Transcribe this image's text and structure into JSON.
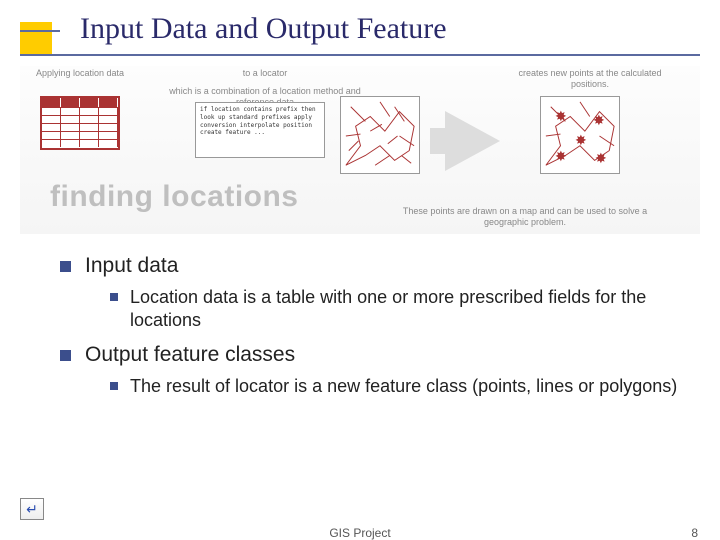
{
  "title": "Input Data and Output Feature",
  "diagram": {
    "label_apply": "Applying location data",
    "label_to": "to a locator",
    "label_combo": "which is a combination of a location method and reference data",
    "label_create": "creates new points at the calculated positions.",
    "label_drawn": "These points are drawn on a map and can be used to solve a geographic problem.",
    "banner": "finding locations",
    "pseudo_code": "if location contains prefix\nthen look up standard prefixes\napply conversion\ninterpolate position\ncreate feature\n..."
  },
  "bullets": {
    "b1": "Input data",
    "b1_1": "Location data is a table with one or more prescribed fields for the locations",
    "b2": "Output feature classes",
    "b2_1": "The result of locator is a new feature class (points, lines or polygons)"
  },
  "footer": {
    "center": "GIS Project",
    "page": "8"
  },
  "icons": {
    "return": "↵"
  }
}
